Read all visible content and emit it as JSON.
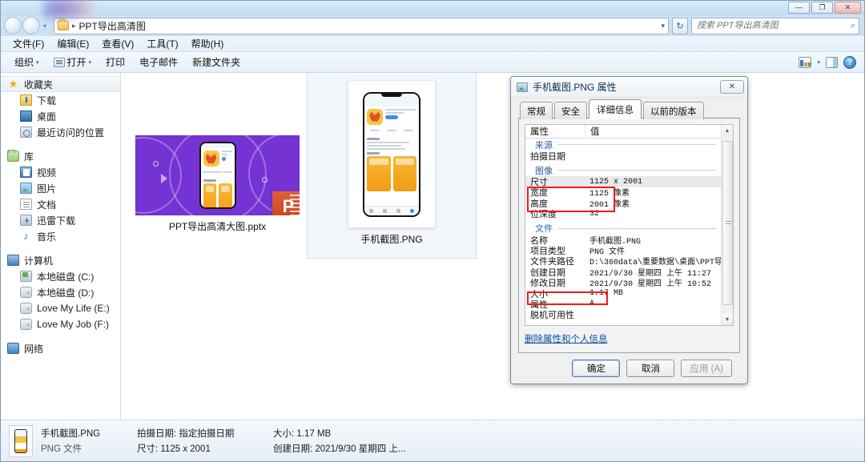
{
  "window": {
    "title": "",
    "buttons": {
      "minimize": "—",
      "maximize": "❐",
      "close": "✕"
    }
  },
  "address_bar": {
    "path_label": "PPT导出高清图",
    "separator": "▸",
    "dropdown_caret": "▾",
    "refresh_label": "↻"
  },
  "search": {
    "placeholder": "搜索 PPT导出高清图",
    "value": "",
    "icon": "search-icon",
    "glyph": "⌕"
  },
  "menubar": {
    "items": [
      {
        "label": "文件(F)"
      },
      {
        "label": "编辑(E)"
      },
      {
        "label": "查看(V)"
      },
      {
        "label": "工具(T)"
      },
      {
        "label": "帮助(H)"
      }
    ]
  },
  "toolbar": {
    "organize": "组织",
    "open": "打开",
    "print": "打印",
    "email": "电子邮件",
    "new_folder": "新建文件夹",
    "caret": "▾",
    "help_glyph": "?"
  },
  "sidebar": {
    "groups": [
      {
        "header": {
          "label": "收藏夹",
          "icon": "star-icon",
          "selected": true
        },
        "items": [
          {
            "label": "下载",
            "icon": "download-icon"
          },
          {
            "label": "桌面",
            "icon": "desktop-icon"
          },
          {
            "label": "最近访问的位置",
            "icon": "recent-places-icon"
          }
        ]
      },
      {
        "header": {
          "label": "库",
          "icon": "library-icon",
          "selected": false
        },
        "items": [
          {
            "label": "视频",
            "icon": "video-icon"
          },
          {
            "label": "图片",
            "icon": "pictures-icon"
          },
          {
            "label": "文档",
            "icon": "documents-icon"
          },
          {
            "label": "迅雷下载",
            "icon": "thunder-download-icon"
          },
          {
            "label": "音乐",
            "icon": "music-icon"
          }
        ]
      },
      {
        "header": {
          "label": "计算机",
          "icon": "computer-icon",
          "selected": false
        },
        "items": [
          {
            "label": "本地磁盘 (C:)",
            "icon": "system-drive-icon"
          },
          {
            "label": "本地磁盘 (D:)",
            "icon": "drive-icon"
          },
          {
            "label": "Love My Life (E:)",
            "icon": "drive-icon"
          },
          {
            "label": "Love My Job (F:)",
            "icon": "drive-icon"
          }
        ]
      },
      {
        "header": {
          "label": "网络",
          "icon": "network-icon",
          "selected": false
        },
        "items": []
      }
    ]
  },
  "files": [
    {
      "name": "PPT导出高清大图.pptx",
      "type": "pptx",
      "badge": "P",
      "selected": false
    },
    {
      "name": "手机截图.PNG",
      "type": "png",
      "selected": true
    }
  ],
  "statusbar": {
    "file_name": "手机截图.PNG",
    "file_type": "PNG 文件",
    "taken_date_label": "拍摄日期: 指定拍摄日期",
    "dimensions_label": "尺寸: 1125 x 2001",
    "size_label": "大小: 1.17 MB",
    "created_label": "创建日期: 2021/9/30 星期四 上..."
  },
  "properties_dialog": {
    "title": "手机截图.PNG 属性",
    "close_glyph": "✕",
    "tabs": [
      {
        "label": "常规",
        "active": false
      },
      {
        "label": "安全",
        "active": false
      },
      {
        "label": "详细信息",
        "active": true
      },
      {
        "label": "以前的版本",
        "active": false
      }
    ],
    "columns": {
      "key": "属性",
      "value": "值"
    },
    "rows": [
      {
        "kind": "section",
        "label": "来源"
      },
      {
        "kind": "row",
        "key": "拍摄日期",
        "value": ""
      },
      {
        "kind": "section",
        "label": "图像"
      },
      {
        "kind": "row",
        "key": "尺寸",
        "value": "1125 x 2001",
        "alt": true
      },
      {
        "kind": "row",
        "key": "宽度",
        "value": "1125 像素"
      },
      {
        "kind": "row",
        "key": "高度",
        "value": "2001 像素"
      },
      {
        "kind": "row",
        "key": "位深度",
        "value": "32"
      },
      {
        "kind": "section",
        "label": "文件"
      },
      {
        "kind": "row",
        "key": "名称",
        "value": "手机截图.PNG"
      },
      {
        "kind": "row",
        "key": "项目类型",
        "value": "PNG 文件"
      },
      {
        "kind": "row",
        "key": "文件夹路径",
        "value": "D:\\360data\\重要数据\\桌面\\PPT导..."
      },
      {
        "kind": "row",
        "key": "创建日期",
        "value": "2021/9/30 星期四 上午 11:27"
      },
      {
        "kind": "row",
        "key": "修改日期",
        "value": "2021/9/30 星期四 上午 10:52"
      },
      {
        "kind": "row",
        "key": "大小",
        "value": "1.17 MB"
      },
      {
        "kind": "row",
        "key": "属性",
        "value": "A"
      },
      {
        "kind": "row",
        "key": "脱机可用性",
        "value": ""
      }
    ],
    "remove_link": "删除属性和个人信息",
    "buttons": {
      "ok": "确定",
      "cancel": "取消",
      "apply": "应用 (A)"
    },
    "scroll": {
      "up": "▲",
      "down": "▼"
    }
  },
  "annotations": {
    "accent_color": "#ee1c1c",
    "boxes": [
      {
        "name": "dimensions-highlight",
        "targets": "宽度 / 高度"
      },
      {
        "name": "size-highlight",
        "targets": "大小"
      }
    ]
  },
  "colors": {
    "accent_red": "#ee1c1c",
    "window_blue": "#bcd9f0",
    "link_blue": "#0b4ea2",
    "section_blue": "#2a5f9e",
    "pptx_purple": "#7633d4"
  }
}
